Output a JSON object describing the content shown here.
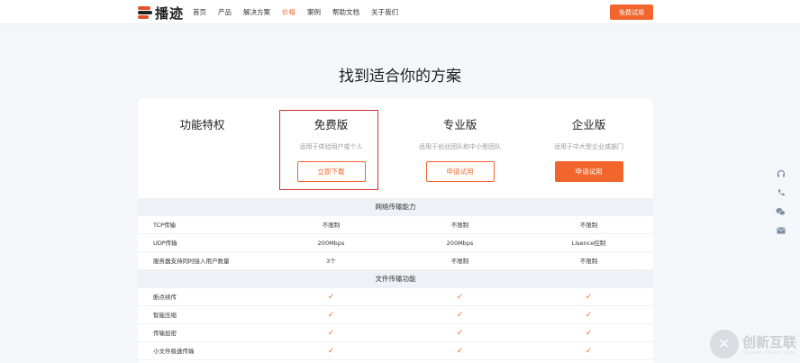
{
  "nav": {
    "brand": "播迹",
    "menu": [
      "首页",
      "产品",
      "解决方案",
      "价格",
      "案例",
      "帮助文档",
      "关于我们"
    ],
    "active_index": 3,
    "trial_button": "免费试用"
  },
  "page_title": "找到适合你的方案",
  "plans": [
    {
      "name": "功能特权"
    },
    {
      "name": "免费版",
      "desc": "适用于体验用户或个人",
      "button": "立即下载"
    },
    {
      "name": "专业版",
      "desc": "适用于创业团队和中小型团队",
      "button": "申请试用"
    },
    {
      "name": "企业版",
      "desc": "适用于中大型企业或部门",
      "button": "申请试用"
    }
  ],
  "sections": [
    {
      "title": "网络传输能力",
      "rows": [
        {
          "label": "TCP传输",
          "values": [
            "不限制",
            "不限制",
            "不限制"
          ]
        },
        {
          "label": "UDP传输",
          "values": [
            "200Mbps",
            "200Mbps",
            "Lisence控制"
          ]
        },
        {
          "label": "服务器支持同时接入用户数量",
          "values": [
            "3个",
            "不限制",
            "不限制"
          ]
        }
      ]
    },
    {
      "title": "文件传输功能",
      "rows": [
        {
          "label": "断点续传",
          "values": [
            "✓",
            "✓",
            "✓"
          ]
        },
        {
          "label": "智能压缩",
          "values": [
            "✓",
            "✓",
            "✓"
          ]
        },
        {
          "label": "传输加密",
          "values": [
            "✓",
            "✓",
            "✓"
          ]
        },
        {
          "label": "小文件极速传输",
          "values": [
            "✓",
            "✓",
            "✓"
          ]
        }
      ]
    }
  ],
  "side_icons": [
    "headset-icon",
    "phone-icon",
    "wechat-icon",
    "mail-icon"
  ],
  "watermark": {
    "text": "创新互联",
    "sub": "CHUANG XIN HU LIAN"
  },
  "colors": {
    "accent": "#f2662e",
    "highlight_box": "#d6312f"
  }
}
